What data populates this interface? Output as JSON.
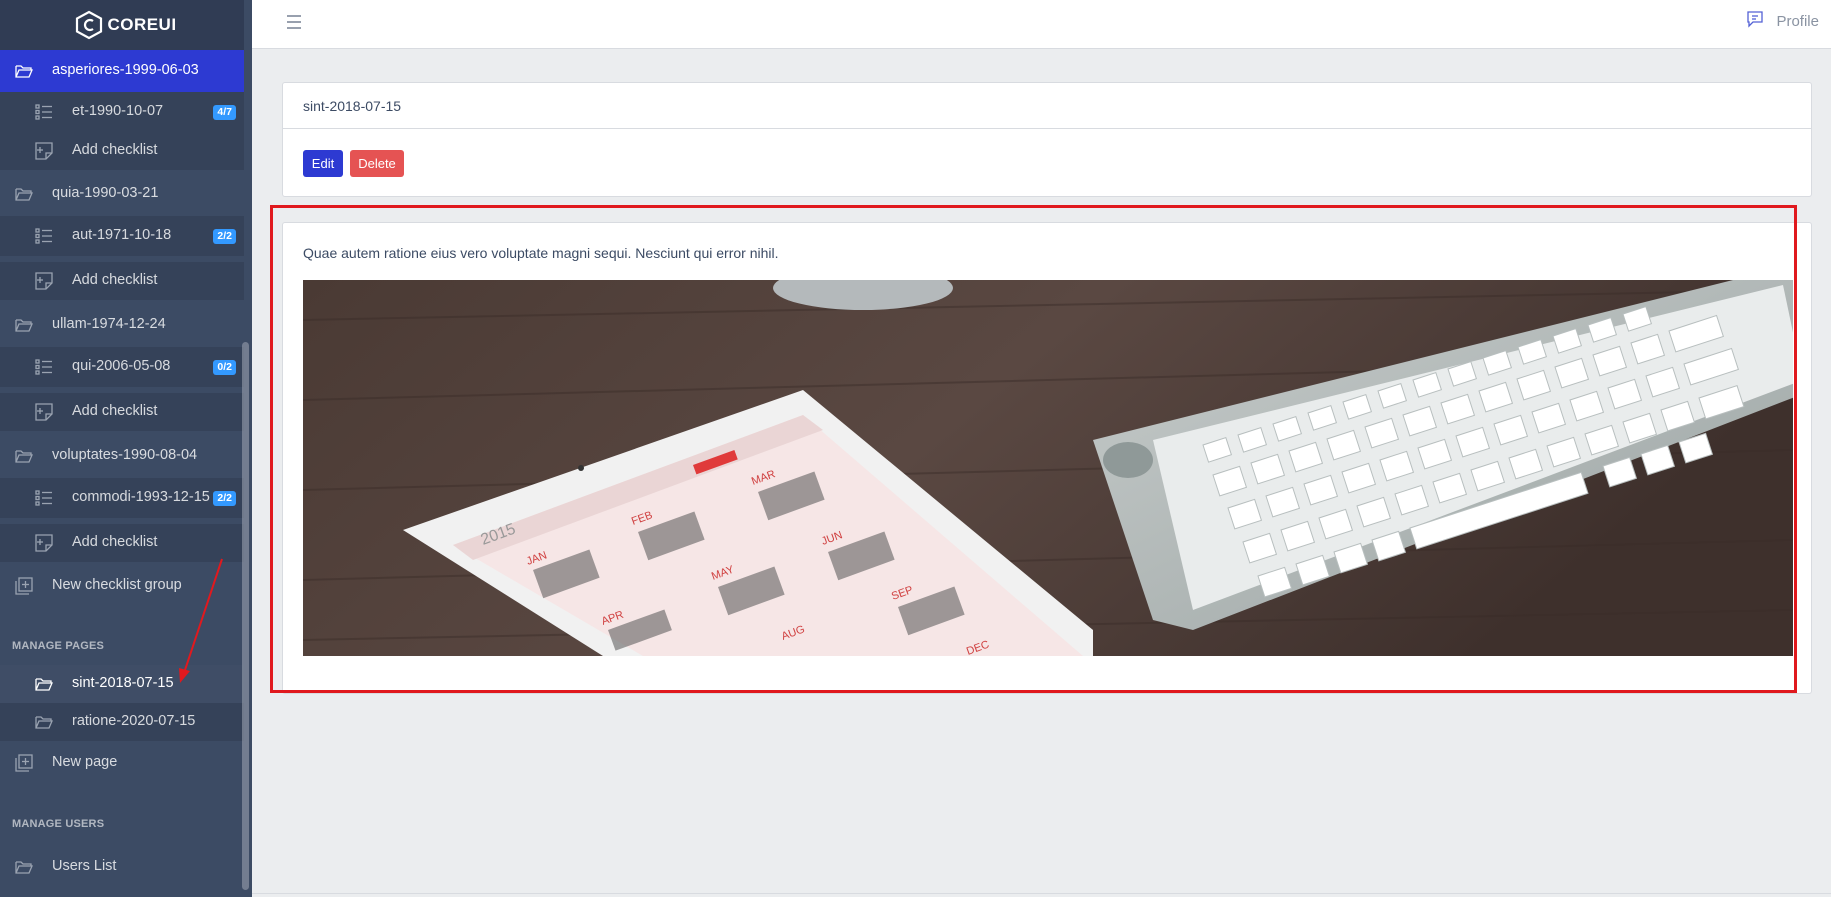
{
  "brand": {
    "name": "COREUI"
  },
  "sidebar": {
    "groups": [
      {
        "label": "asperiores-1999-06-03",
        "checklists": [
          {
            "label": "et-1990-10-07",
            "badge": "4/7"
          }
        ],
        "add_label": "Add checklist"
      },
      {
        "label": "quia-1990-03-21",
        "checklists": [
          {
            "label": "aut-1971-10-18",
            "badge": "2/2"
          }
        ],
        "add_label": "Add checklist"
      },
      {
        "label": "ullam-1974-12-24",
        "checklists": [
          {
            "label": "qui-2006-05-08",
            "badge": "0/2"
          }
        ],
        "add_label": "Add checklist"
      },
      {
        "label": "voluptates-1990-08-04",
        "checklists": [
          {
            "label": "commodi-1993-12-15",
            "badge": "2/2"
          }
        ],
        "add_label": "Add checklist"
      }
    ],
    "new_group_label": "New checklist group",
    "manage_pages_title": "MANAGE PAGES",
    "pages": [
      {
        "label": "sint-2018-07-15"
      },
      {
        "label": "ratione-2020-07-15"
      }
    ],
    "new_page_label": "New page",
    "manage_users_title": "MANAGE USERS",
    "users_list_label": "Users List"
  },
  "header": {
    "profile_label": "Profile"
  },
  "page": {
    "title": "sint-2018-07-15",
    "edit_label": "Edit",
    "delete_label": "Delete",
    "content_text": "Quae autem ratione eius vero voluptate magni sequi. Nesciunt qui error nihil.",
    "image_alt": "tablet and keyboard on desk",
    "calendar_year": "2015",
    "calendar_months": [
      "JAN",
      "FEB",
      "MAR",
      "APR",
      "MAY",
      "JUN",
      "AUG",
      "SEP",
      "DEC"
    ]
  },
  "colors": {
    "sidebar": "#3c4b64",
    "active": "#2d3ad2",
    "badge": "#3399ff",
    "danger": "#e55353",
    "highlight": "#e0191e"
  }
}
